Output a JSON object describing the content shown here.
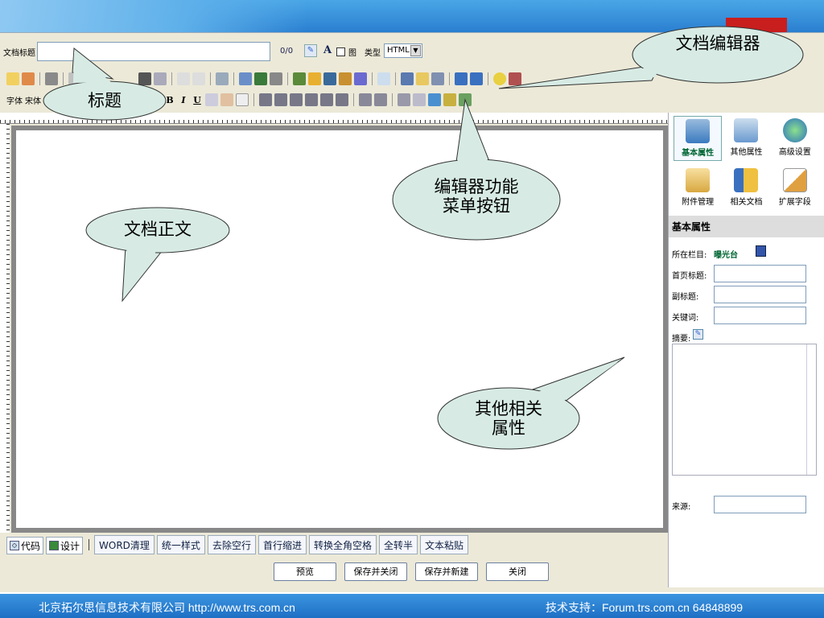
{
  "toolbar": {
    "title_label": "文档标题",
    "char_count": "0/0",
    "font_A": "A",
    "image_label": "图",
    "type_label": "类型",
    "type_value": "HTML",
    "font_label": "字体",
    "font_value": "宋体",
    "bold": "B",
    "italic": "I",
    "underline": "U"
  },
  "editor": {
    "mode_tabs": [
      "代码",
      "设计"
    ],
    "tool_tabs": [
      "WORD清理",
      "统一样式",
      "去除空行",
      "首行缩进",
      "转换全角空格",
      "全转半",
      "文本粘贴"
    ]
  },
  "actions": {
    "preview": "预览",
    "save_close": "保存并关闭",
    "save_new": "保存并新建",
    "close": "关闭"
  },
  "sidebar": {
    "tabs": [
      "基本属性",
      "其他属性",
      "高级设置",
      "附件管理",
      "相关文档",
      "扩展字段"
    ],
    "section_title": "基本属性",
    "column_label": "所在栏目:",
    "column_value": "曝光台",
    "home_title_label": "首页标题:",
    "subtitle_label": "副标题:",
    "keywords_label": "关键词:",
    "summary_label": "摘要:",
    "source_label": "来源:"
  },
  "callouts": {
    "title": "标题",
    "editor": "文档编辑器",
    "menu": "编辑器功能菜单按钮",
    "body": "文档正文",
    "other": "其他相关属性"
  },
  "footer": {
    "company": "北京拓尔思信息技术有限公司   http://www.trs.com.cn",
    "support": "技术支持：Forum.trs.com.cn    64848899"
  },
  "colors": {
    "header_blue": "#2a7fd0",
    "callout_fill": "#d7ebe4",
    "active_green": "#063"
  }
}
